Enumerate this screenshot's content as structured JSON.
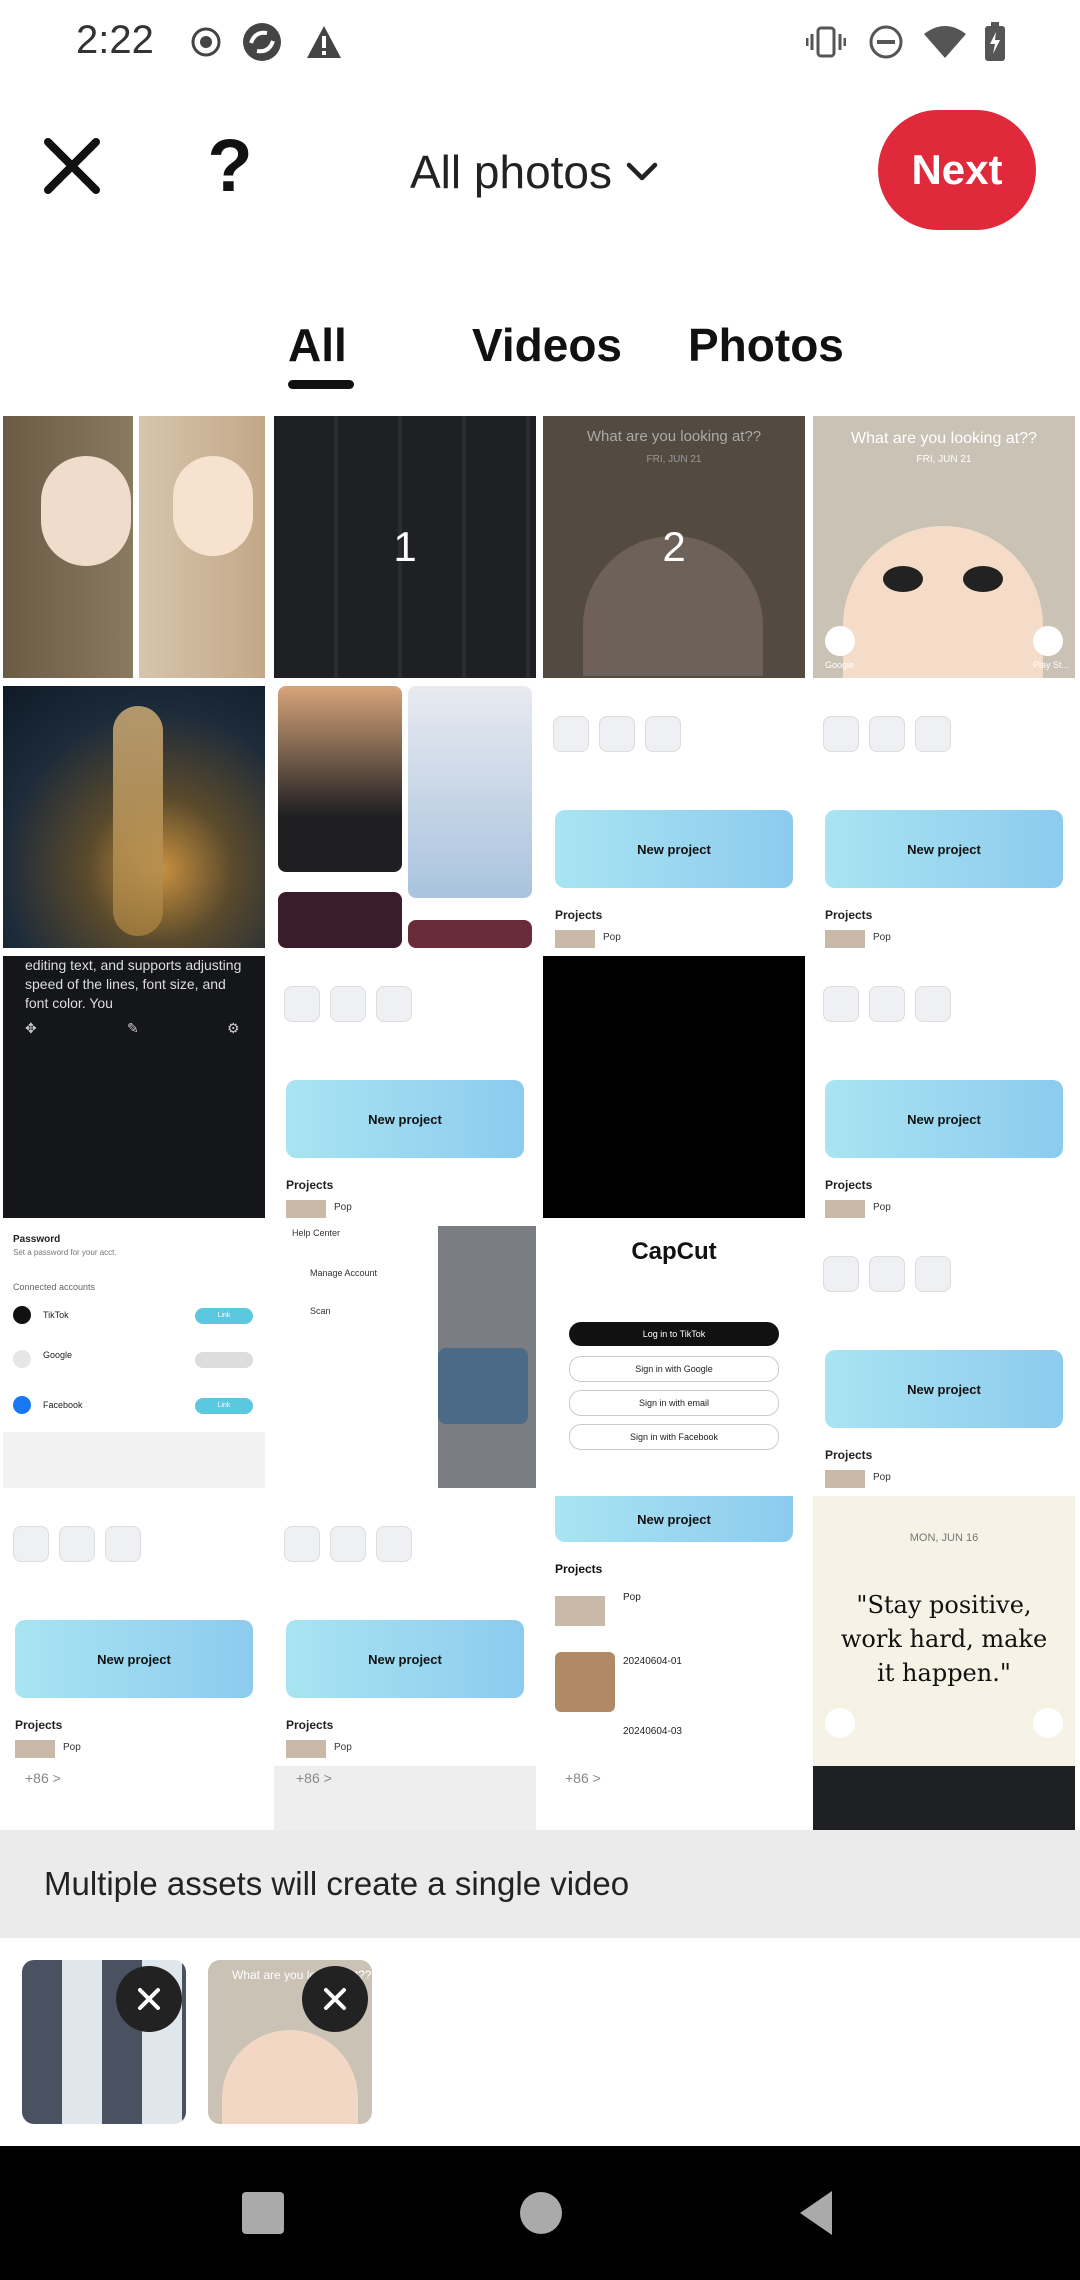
{
  "status_bar": {
    "time": "2:22"
  },
  "top_bar": {
    "album_label": "All photos",
    "next_label": "Next"
  },
  "tabs": [
    {
      "label": "All",
      "selected": true
    },
    {
      "label": "Videos",
      "selected": false
    },
    {
      "label": "Photos",
      "selected": false
    }
  ],
  "grid": {
    "selection_numbers": [
      "1",
      "2"
    ],
    "lock_text": "What are you looking at??",
    "lock_date": "FRI, JUN 21",
    "google_label": "Google",
    "playstore_label": "Play St...",
    "new_project_label": "New project",
    "projects_label": "Projects",
    "pop_label": "Pop",
    "caption_text": "editing text, and supports adjusting speed of the lines, font size, and font color. You",
    "account": {
      "password_label": "Password",
      "password_sub": "Set a password for your acct.",
      "connected_label": "Connected accounts",
      "tiktok": "TikTok",
      "google": "Google",
      "facebook": "Facebook",
      "link": "Link"
    },
    "menu": {
      "help": "Help Center",
      "manage": "Manage Account",
      "scan": "Scan"
    },
    "capcut": {
      "logo": "CapCut",
      "login_tiktok": "Log in to TikTok",
      "sign_google": "Sign in with Google",
      "sign_email": "Sign in with email",
      "sign_facebook": "Sign in with Facebook"
    },
    "projects_list": [
      "Pop",
      "20240604-01",
      "20240604-03"
    ],
    "phone_prefix": "+86 >",
    "quote_date": "MON, JUN 16",
    "quote": "\"Stay positive, work hard, make it happen.\""
  },
  "banner_text": "Multiple assets will create a single video",
  "colors": {
    "accent": "#e0293a",
    "banner_bg": "#ebebeb",
    "nav_bg": "#000000"
  }
}
